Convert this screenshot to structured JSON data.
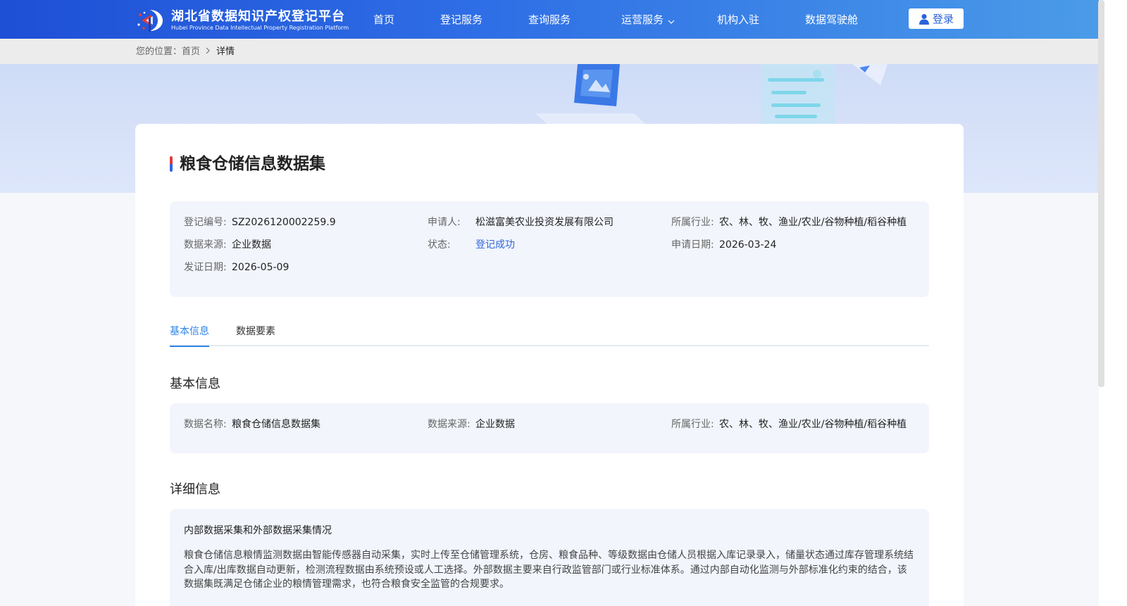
{
  "header": {
    "logo_cn": "湖北省数据知识产权登记平台",
    "logo_en": "Hubei Province Data Intellectual Property Registration Platform",
    "nav": [
      {
        "label": "首页"
      },
      {
        "label": "登记服务"
      },
      {
        "label": "查询服务"
      },
      {
        "label": "运营服务"
      },
      {
        "label": "机构入驻"
      },
      {
        "label": "数据驾驶舱"
      }
    ],
    "login_label": "登录"
  },
  "breadcrumb": {
    "prefix": "您的位置：",
    "home": "首页",
    "current": "详情"
  },
  "detail": {
    "title": "粮食仓储信息数据集",
    "summary": [
      {
        "key": "登记编号:",
        "value": "SZ2026120002259.9"
      },
      {
        "key": "申请人:",
        "value": "松滋富美农业投资发展有限公司"
      },
      {
        "key": "所属行业:",
        "value": "农、林、牧、渔业/农业/谷物种植/稻谷种植"
      },
      {
        "key": "数据来源:",
        "value": "企业数据"
      },
      {
        "key": "状态:",
        "value": "登记成功"
      },
      {
        "key": "申请日期:",
        "value": "2026-03-24"
      },
      {
        "key": "发证日期:",
        "value": "2026-05-09"
      }
    ],
    "status_color": "#2f66e0"
  },
  "tabs": [
    {
      "label": "基本信息",
      "active": true
    },
    {
      "label": "数据要素",
      "active": false
    }
  ],
  "basic": {
    "section_title": "基本信息",
    "fields": [
      {
        "key": "数据名称:",
        "value": "粮食仓储信息数据集"
      },
      {
        "key": "数据来源:",
        "value": "企业数据"
      },
      {
        "key": "所属行业:",
        "value": "农、林、牧、渔业/农业/谷物种植/稻谷种植"
      }
    ]
  },
  "more": {
    "section_title": "详细信息",
    "heading": "内部数据采集和外部数据采集情况",
    "text": "粮食仓储信息粮情监测数据由智能传感器自动采集，实时上传至仓储管理系统，仓房、粮食品种、等级数据由仓储人员根据入库记录录入，储量状态通过库存管理系统结合入库/出库数据自动更新，检测流程数据由系统预设或人工选择。外部数据主要来自行政监管部门或行业标准体系。通过内部自动化监测与外部标准化约束的结合，该数据集既满足仓储企业的粮情管理需求，也符合粮食安全监管的合规要求。"
  },
  "icons": [
    "logo-mark-icon",
    "user-icon",
    "chevron-down-icon",
    "chevron-right-icon"
  ]
}
